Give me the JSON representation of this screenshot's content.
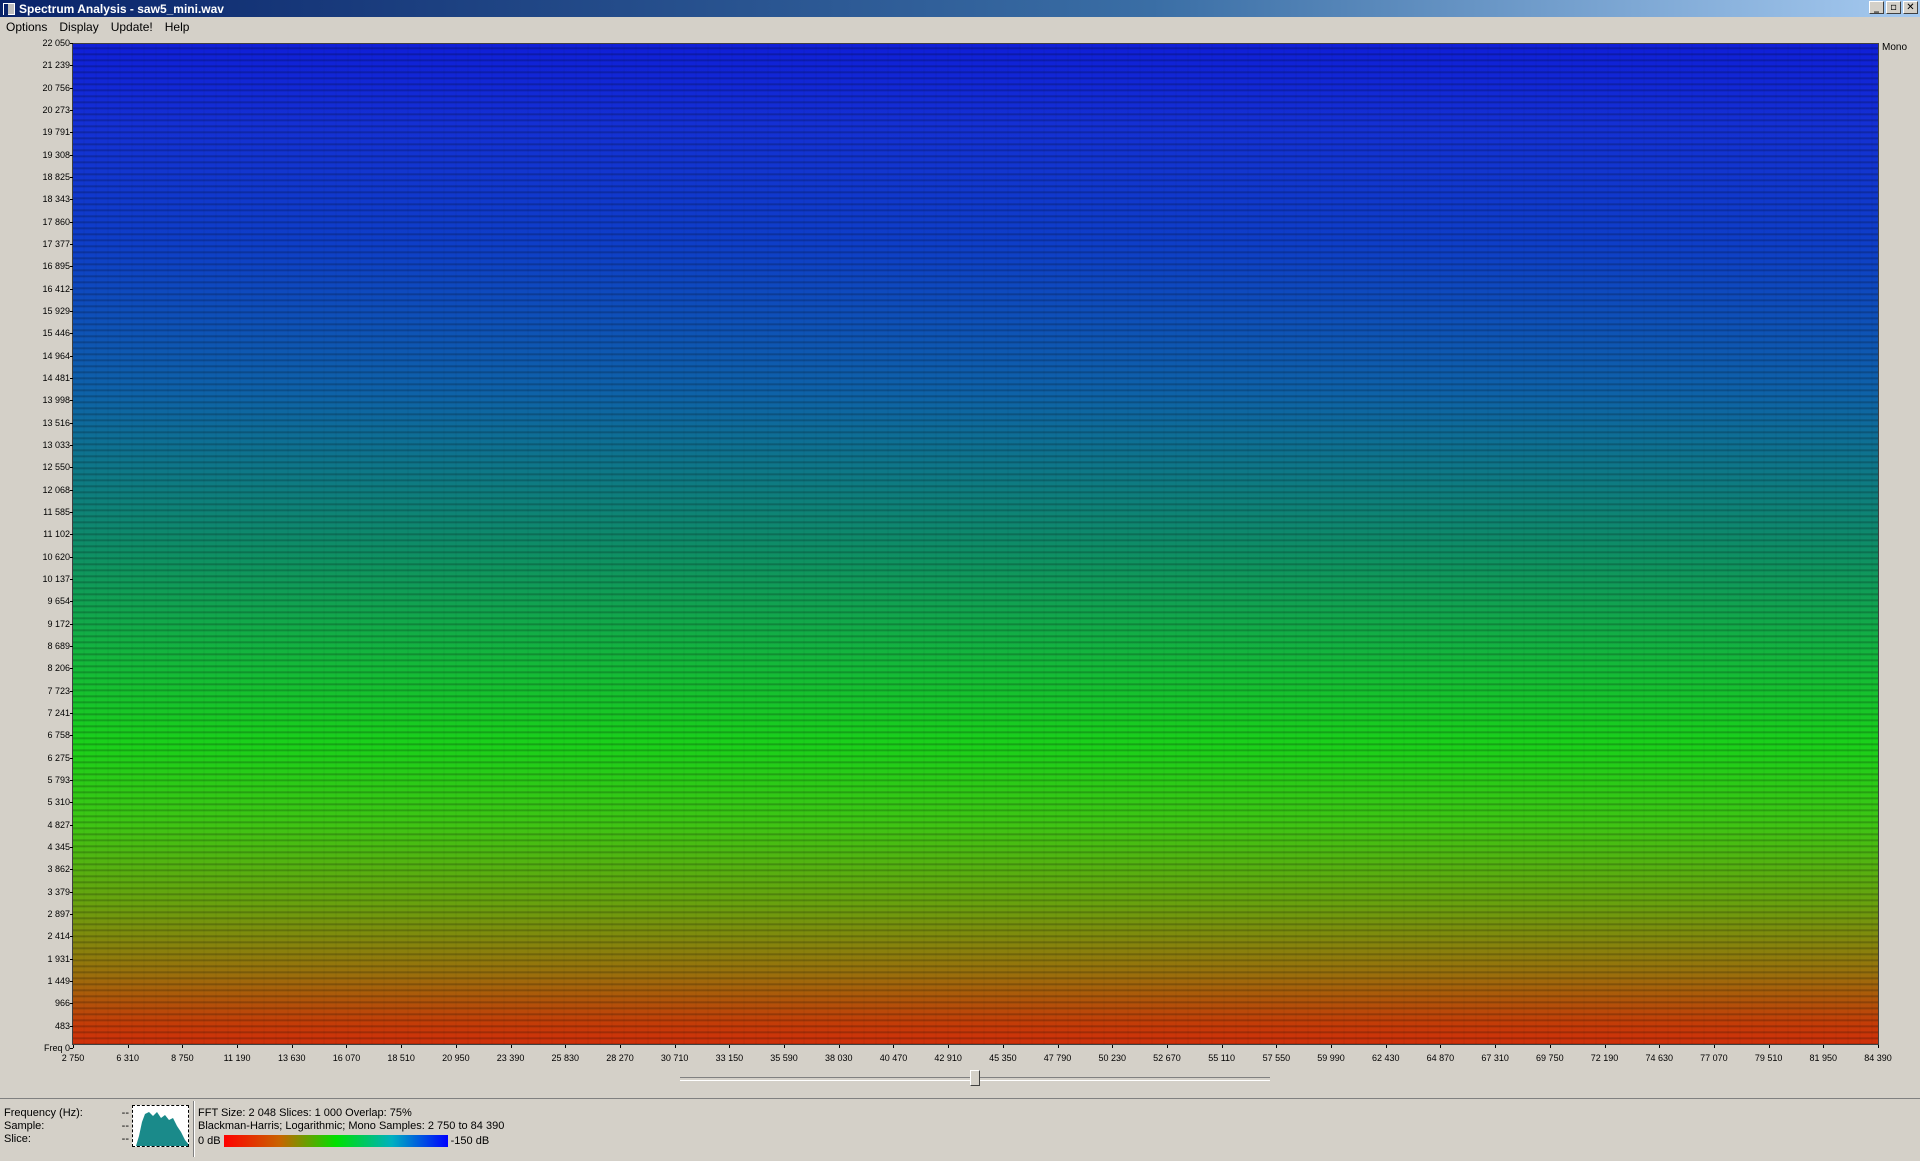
{
  "window": {
    "title": "Spectrum Analysis - saw5_mini.wav",
    "buttons": [
      "_",
      "▫",
      "✕"
    ]
  },
  "menu": [
    "Options",
    "Display",
    "Update!",
    "Help"
  ],
  "spectrogram": {
    "channel_label": "Mono",
    "freq_axis_label": "Freq",
    "freq_ticks": [
      "22 050",
      "21 239",
      "20 756",
      "20 273",
      "19 791",
      "19 308",
      "18 825",
      "18 343",
      "17 860",
      "17 377",
      "16 895",
      "16 412",
      "15 929",
      "15 446",
      "14 964",
      "14 481",
      "13 998",
      "13 516",
      "13 033",
      "12 550",
      "12 068",
      "11 585",
      "11 102",
      "10 620",
      "10 137",
      "9 654",
      "9 172",
      "8 689",
      "8 206",
      "7 723",
      "7 241",
      "6 758",
      "6 275",
      "5 793",
      "5 310",
      "4 827",
      "4 345",
      "3 862",
      "3 379",
      "2 897",
      "2 414",
      "1 931",
      "1 449",
      "966",
      "483",
      "0"
    ],
    "sample_ticks": [
      "2 750",
      "6 310",
      "8 750",
      "11 190",
      "13 630",
      "16 070",
      "18 510",
      "20 950",
      "23 390",
      "25 830",
      "28 270",
      "30 710",
      "33 150",
      "35 590",
      "38 030",
      "40 470",
      "42 910",
      "45 350",
      "47 790",
      "50 230",
      "52 670",
      "55 110",
      "57 550",
      "59 990",
      "62 430",
      "64 870",
      "67 310",
      "69 750",
      "72 190",
      "74 630",
      "77 070",
      "79 510",
      "81 950",
      "84 390"
    ]
  },
  "slider": {
    "position": 0.5
  },
  "status": {
    "frequency_label": "Frequency (Hz):",
    "sample_label": "Sample:",
    "slice_label": "Slice:",
    "frequency_value": "--",
    "sample_value": "--",
    "slice_value": "--",
    "info_line1": "FFT Size: 2 048  Slices: 1 000  Overlap: 75%",
    "info_line2": "Blackman-Harris; Logarithmic; Mono  Samples: 2 750 to 84 390",
    "legend_min": "0 dB",
    "legend_max": "-150 dB"
  },
  "colors": {
    "title_start": "#0a246a",
    "window_bg": "#d4d0c8",
    "waveform": "#1a8a8a"
  }
}
